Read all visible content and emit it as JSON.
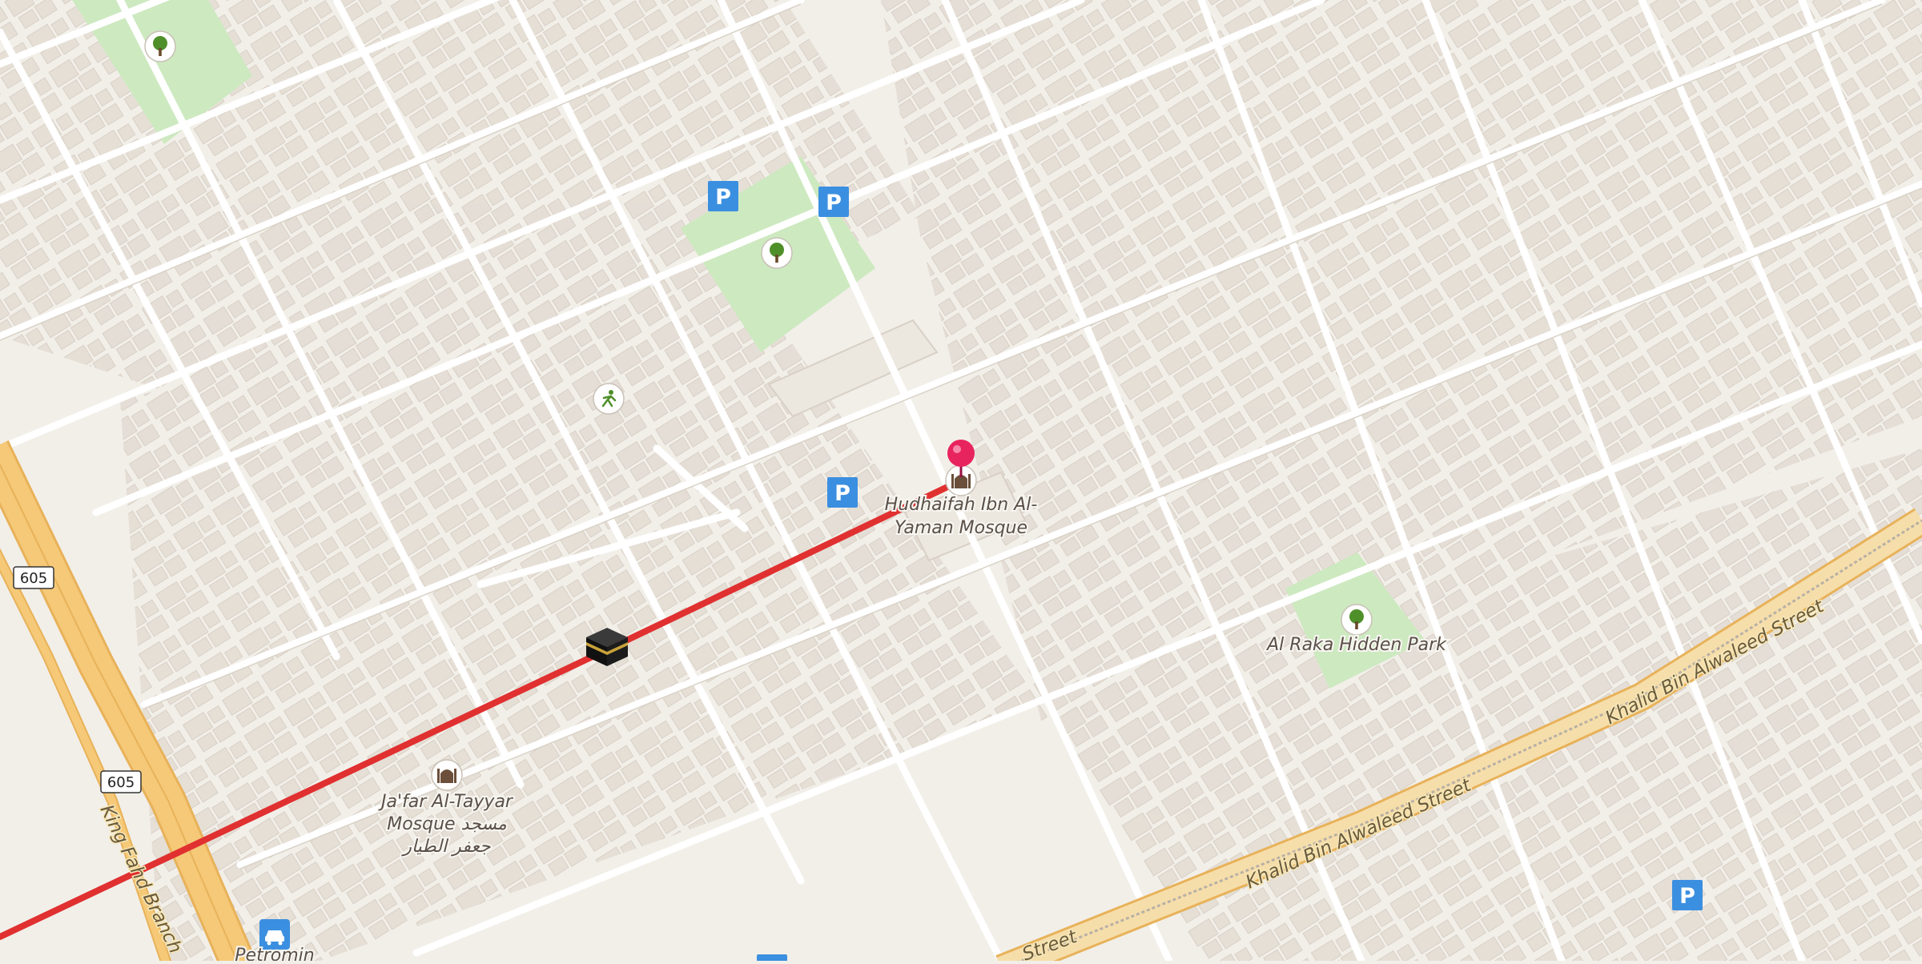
{
  "map": {
    "pois": {
      "mosque_main": "Hudhaifah Ibn Al-Yaman Mosque",
      "mosque_main_line1": "Hudhaifah Ibn Al-",
      "mosque_main_line2": "Yaman Mosque",
      "mosque_second_line1": "Ja'far Al-Tayyar",
      "mosque_second_line2": "Mosque مسجد",
      "mosque_second_line3": "جعفر الطيار",
      "park": "Al Raka Hidden Park",
      "fuel": "Petromin"
    },
    "roads": {
      "king_fahd": "King Fahd Branch",
      "khalid_1": "Khalid Bin Alwaleed Street",
      "khalid_2": "Khalid Bin Alwaleed Street",
      "khalid_partial": "Street",
      "route_605": "605"
    },
    "icons": {
      "parking": "P",
      "pin": "location-pin-icon",
      "kaaba": "kaaba-icon",
      "tree": "tree-icon",
      "mosque": "mosque-icon",
      "sport": "running-icon",
      "car": "car-icon"
    },
    "colors": {
      "background": "#f2efe9",
      "building": "#e4ddd4",
      "park": "#cde9c0",
      "motorway": "#f5c978",
      "route_line": "#e03030",
      "pin": "#e8245e",
      "parking": "#3b8fe0"
    }
  }
}
